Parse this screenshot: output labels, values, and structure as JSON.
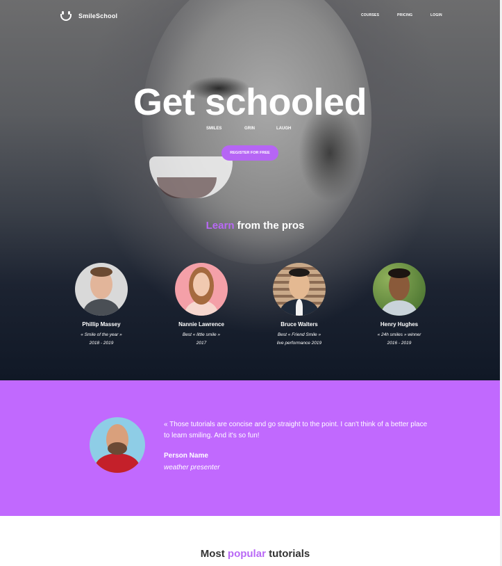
{
  "nav": {
    "brand": "SmileSchool",
    "links": [
      "COURSES",
      "PRICING",
      "LOGIN"
    ]
  },
  "hero": {
    "title": "Get schooled",
    "tags": [
      "SMILES",
      "GRIN",
      "LAUGH"
    ],
    "cta": "REGISTER FOR FREE"
  },
  "pros_section": {
    "heading_accent": "Learn",
    "heading_rest": "from the pros",
    "pros": [
      {
        "name": "Phillip Massey",
        "line1": "« Smile of the year »",
        "line2": "2018 - 2019"
      },
      {
        "name": "Nannie Lawrence",
        "line1": "Best « little smile »",
        "line2": "2017"
      },
      {
        "name": "Bruce Walters",
        "line1": "Best « Friend Smile »",
        "line2": "live performance 2019"
      },
      {
        "name": "Henry Hughes",
        "line1": "« 24h smiles » winner",
        "line2": "2016 - 2019"
      }
    ]
  },
  "testimonial": {
    "quote": "« Those tutorials are concise and go straight to the point. I can't think of a better place to learn smiling. And it's so fun!",
    "name": "Person Name",
    "role": "weather presenter"
  },
  "popular": {
    "prefix": "Most",
    "accent": "popular",
    "suffix": "tutorials"
  },
  "colors": {
    "accent": "#c169fe",
    "button": "#b665f5"
  }
}
